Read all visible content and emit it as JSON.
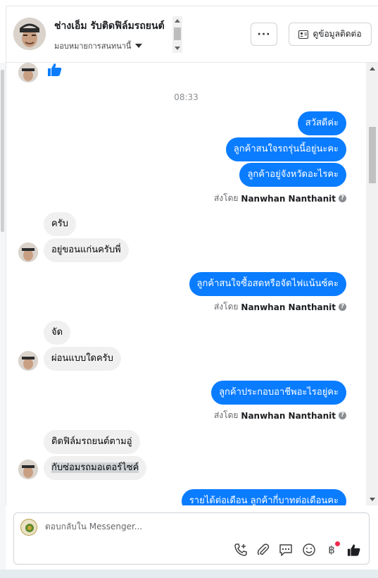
{
  "header": {
    "page_name": "ช่างเอ็ม รับติดฟิล์มรถยนต์",
    "assign_label": "มอบหมายการสนทนานี้",
    "more_label": "···",
    "contact_label": "ดูข้อมูลติดต่อ"
  },
  "chat": {
    "timestamp": "08:33",
    "sent_by_prefix": "ส่งโดย",
    "agent_name": "Nanwhan Nanthanit",
    "messages": {
      "out1": "สวัสดีค่ะ",
      "out2": "ลูกค้าสนใจรถรุ่นนี้อยู่นะคะ",
      "out3": "ลูกค้าอยู่จังหวัดอะไรคะ",
      "in1": "ครับ",
      "in2": "อยู่ขอนแก่นครับพี่",
      "out4": "ลูกค้าสนใจซื้อสดหรือจัดไฟแน้นซ์คะ",
      "in3": "จัด",
      "in4": "ผ่อนแบบใดครับ",
      "out5": "ลูกค้าประกอบอาชีพอะไรอยู่คะ",
      "in5": "ติดฟิล์มรถยนต์ตามอู่",
      "in6": "กับซ่อมรถมอเตอร์ไซค์",
      "out6": "รายได้ต่อเดือน ลูกค้ากี่บาทต่อเดือนคะ"
    }
  },
  "composer": {
    "placeholder": "ตอบกลับใน Messenger..."
  },
  "colors": {
    "accent": "#0a7cff",
    "incoming": "#f0f0f0",
    "notification": "#f02849"
  }
}
